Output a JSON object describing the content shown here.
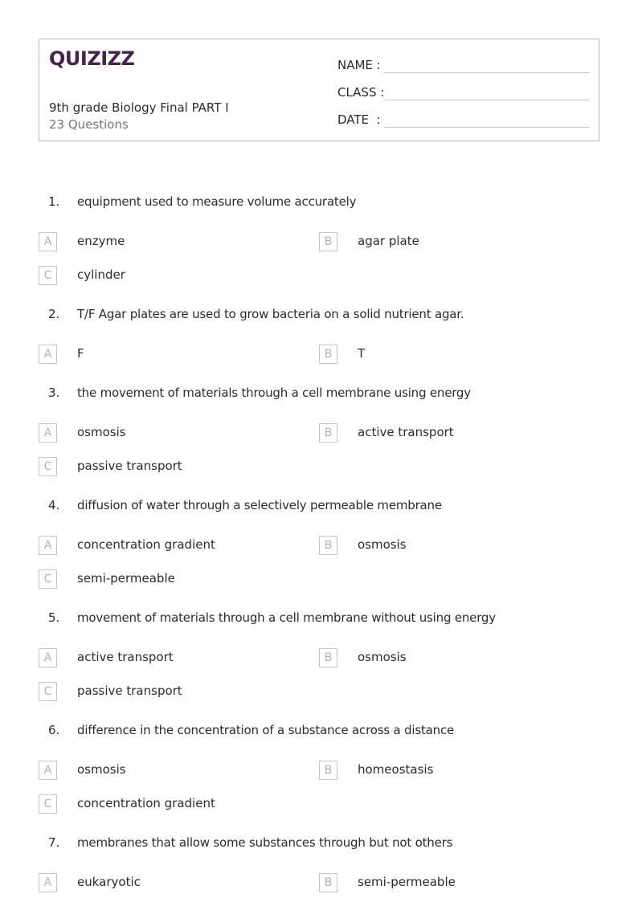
{
  "header": {
    "logo_text": "QUIZIZZ",
    "brand_color": "#46224e",
    "title": "9th grade Biology Final PART I",
    "subtitle": "23 Questions",
    "fields": [
      {
        "label": "NAME :",
        "value": ""
      },
      {
        "label": "CLASS :",
        "value": ""
      },
      {
        "label": "DATE  :",
        "value": ""
      }
    ]
  },
  "questions": [
    {
      "number": "1.",
      "text": "equipment used to measure volume accurately",
      "options": [
        {
          "letter": "A",
          "text": "enzyme"
        },
        {
          "letter": "B",
          "text": "agar plate"
        },
        {
          "letter": "C",
          "text": "cylinder"
        }
      ]
    },
    {
      "number": "2.",
      "text": "T/F Agar plates are used to grow bacteria on a solid nutrient agar.",
      "options": [
        {
          "letter": "A",
          "text": "F"
        },
        {
          "letter": "B",
          "text": "T"
        }
      ]
    },
    {
      "number": "3.",
      "text": "the movement of materials through a cell membrane using energy",
      "options": [
        {
          "letter": "A",
          "text": "osmosis"
        },
        {
          "letter": "B",
          "text": "active transport"
        },
        {
          "letter": "C",
          "text": "passive transport"
        }
      ]
    },
    {
      "number": "4.",
      "text": "diffusion of water through a selectively permeable membrane",
      "options": [
        {
          "letter": "A",
          "text": "concentration gradient"
        },
        {
          "letter": "B",
          "text": "osmosis"
        },
        {
          "letter": "C",
          "text": "semi-permeable"
        }
      ]
    },
    {
      "number": "5.",
      "text": "movement of materials through a cell membrane without using energy",
      "options": [
        {
          "letter": "A",
          "text": "active transport"
        },
        {
          "letter": "B",
          "text": "osmosis"
        },
        {
          "letter": "C",
          "text": "passive transport"
        }
      ]
    },
    {
      "number": "6.",
      "text": "difference in the concentration of a substance across a distance",
      "options": [
        {
          "letter": "A",
          "text": "osmosis"
        },
        {
          "letter": "B",
          "text": "homeostasis"
        },
        {
          "letter": "C",
          "text": "concentration gradient"
        }
      ]
    },
    {
      "number": "7.",
      "text": "membranes that allow some substances through but not others",
      "options": [
        {
          "letter": "A",
          "text": "eukaryotic"
        },
        {
          "letter": "B",
          "text": "semi-permeable"
        }
      ]
    }
  ]
}
